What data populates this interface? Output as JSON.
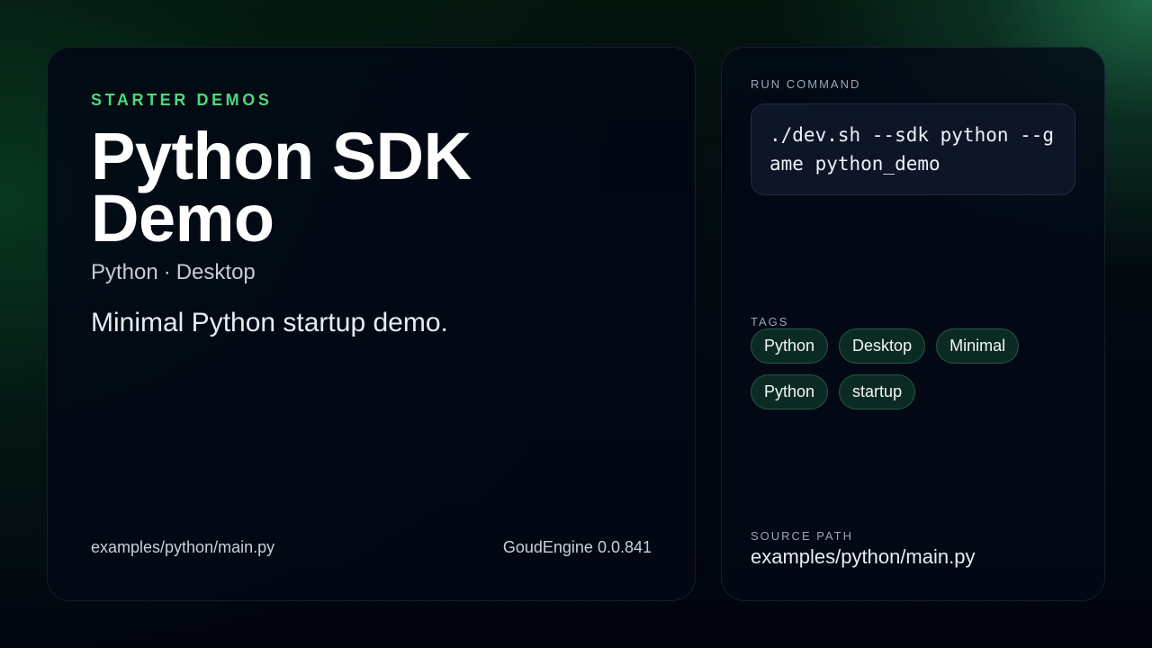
{
  "hero": {
    "eyebrow": "STARTER DEMOS",
    "title": "Python SDK Demo",
    "subtitle_language": "Python",
    "subtitle_separator": "·",
    "subtitle_platform": "Desktop",
    "description": "Minimal Python startup demo.",
    "footer_path": "examples/python/main.py",
    "footer_version": "GoudEngine 0.0.841"
  },
  "details": {
    "run_command_label": "RUN COMMAND",
    "run_command": "./dev.sh --sdk python --game python_demo",
    "tags_label": "TAGS",
    "tags": [
      "Python",
      "Desktop",
      "Minimal",
      "Python",
      "startup"
    ],
    "source_path_label": "SOURCE PATH",
    "source_path": "examples/python/main.py"
  },
  "colors": {
    "accent": "#4cd97a",
    "tag_background": "#0c2a24",
    "card_background": "#020814"
  }
}
